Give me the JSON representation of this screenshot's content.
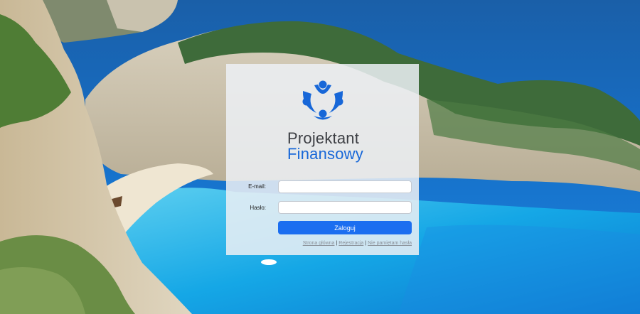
{
  "brand": {
    "name_line1": "Projektant",
    "name_line2": "Finansowy",
    "logo_icon": "three-people-logo-icon",
    "accent_color": "#1767d8"
  },
  "form": {
    "email_label": "E-mail:",
    "email_value": "",
    "password_label": "Hasło:",
    "password_value": "",
    "submit_label": "Zaloguj"
  },
  "footer": {
    "links": [
      {
        "label": "Strona główna"
      },
      {
        "label": "Rejestracja"
      },
      {
        "label": "Nie pamiętam hasła"
      }
    ]
  },
  "colors": {
    "button": "#1b6ef0",
    "panel": "rgba(236,240,245,0.86)"
  }
}
